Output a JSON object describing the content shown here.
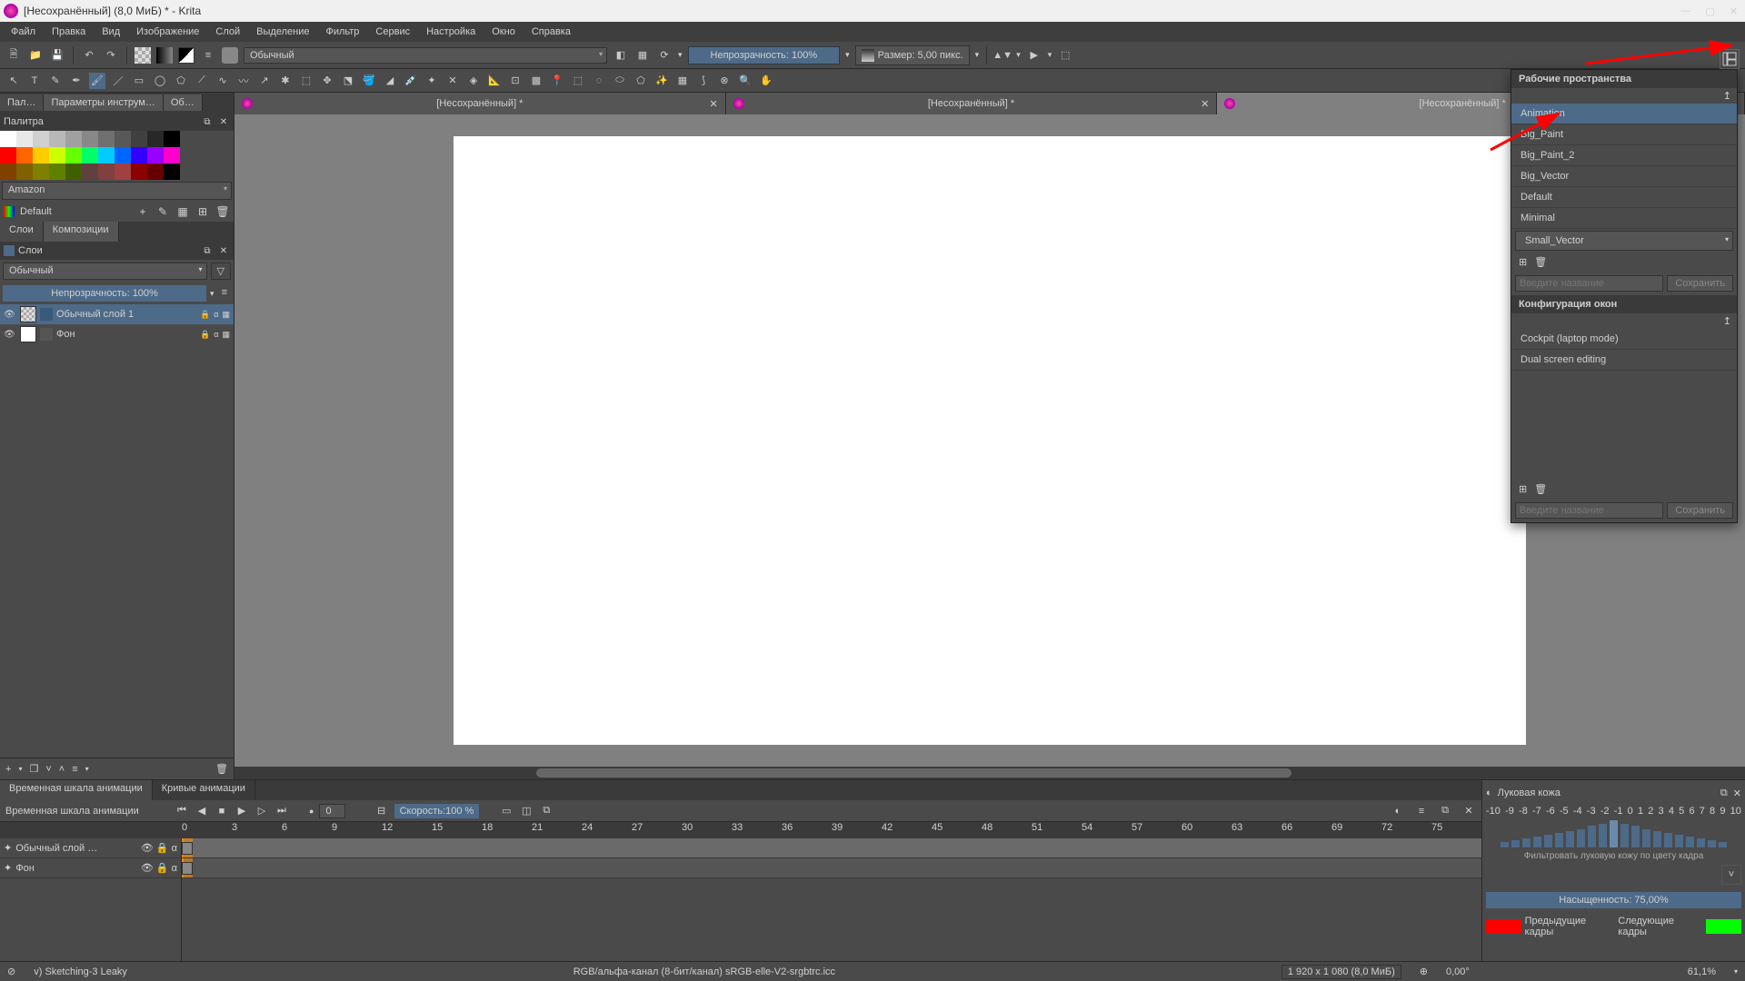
{
  "title": "[Несохранённый]  (8,0 МиБ)  * - Krita",
  "menu": [
    "Файл",
    "Правка",
    "Вид",
    "Изображение",
    "Слой",
    "Выделение",
    "Фильтр",
    "Сервис",
    "Настройка",
    "Окно",
    "Справка"
  ],
  "toolbar": {
    "blend_mode": "Обычный",
    "opacity_label": "Непрозрачность: 100%",
    "size_label": "Размер: 5,00 пикс."
  },
  "docks": {
    "palette_tabs": [
      "Пал…",
      "Параметры инструм…",
      "Об…"
    ],
    "palette_title": "Палитра",
    "palette_preset": "Amazon",
    "palette_default": "Default",
    "layer_tabs": [
      "Слои",
      "Композиции"
    ],
    "layers_title": "Слои",
    "blend": "Обычный",
    "opacity": "Непрозрачность:  100%",
    "layers": [
      {
        "name": "Обычный слой 1",
        "thumb": "checker"
      },
      {
        "name": "Фон",
        "thumb": "white"
      }
    ]
  },
  "doc_tabs": [
    "[Несохранённый] *",
    "[Несохранённый] *",
    "[Несохранённый] *"
  ],
  "timeline": {
    "tabs": [
      "Временная шкала анимации",
      "Кривые анимации"
    ],
    "title": "Временная шкала анимации",
    "frame": "0",
    "speed": "Скорость:100 %",
    "ruler": [
      "0",
      "3",
      "6",
      "9",
      "12",
      "15",
      "18",
      "21",
      "24",
      "27",
      "30",
      "33",
      "36",
      "39",
      "42",
      "45",
      "48",
      "51",
      "54",
      "57",
      "60",
      "63",
      "66",
      "69",
      "72",
      "75"
    ],
    "tracks": [
      "Обычный слой …",
      "Фон"
    ]
  },
  "onion": {
    "title": "Луковая кожа",
    "nums": [
      "-10",
      "-9",
      "-8",
      "-7",
      "-6",
      "-5",
      "-4",
      "-3",
      "-2",
      "-1",
      "0",
      "1",
      "2",
      "3",
      "4",
      "5",
      "6",
      "7",
      "8",
      "9",
      "10"
    ],
    "filter": "Фильтровать луковую кожу по цвету кадра",
    "saturation": "Насыщенность: 75,00%",
    "prev": "Предыдущие кадры",
    "next": "Следующие кадры"
  },
  "workspace": {
    "title": "Рабочие пространства",
    "items": [
      "Animation",
      "Big_Paint",
      "Big_Paint_2",
      "Big_Vector",
      "Default",
      "Minimal",
      "Small_Vector"
    ],
    "selected": "Animation",
    "input_ph": "Введите название",
    "save": "Сохранить",
    "win_config": "Конфигурация окон",
    "win_items": [
      "Cockpit (laptop mode)",
      "Dual screen editing"
    ]
  },
  "status": {
    "brush": "v) Sketching-3 Leaky",
    "color": "RGB/альфа-канал (8-бит/канал)  sRGB-elle-V2-srgbtrc.icc",
    "dims": "1 920 x 1 080 (8,0 МиБ)",
    "angle": "0,00°",
    "zoom": "61,1%"
  },
  "palette_colors_row1": [
    "#ffffff",
    "#e8e8e8",
    "#d0d0d0",
    "#b8b8b8",
    "#a0a0a0",
    "#888888",
    "#707070",
    "#585858",
    "#404040",
    "#282828",
    "#000000"
  ],
  "palette_colors_row2": [
    "#ff0000",
    "#ff6600",
    "#ffcc00",
    "#ccff00",
    "#66ff00",
    "#00ff66",
    "#00ccff",
    "#0066ff",
    "#3300ff",
    "#9900ff",
    "#ff00cc"
  ],
  "palette_colors_row3": [
    "#804000",
    "#806000",
    "#808000",
    "#608000",
    "#406000",
    "#604040",
    "#804040",
    "#a04040",
    "#8b0000",
    "#660000",
    "#000000"
  ]
}
